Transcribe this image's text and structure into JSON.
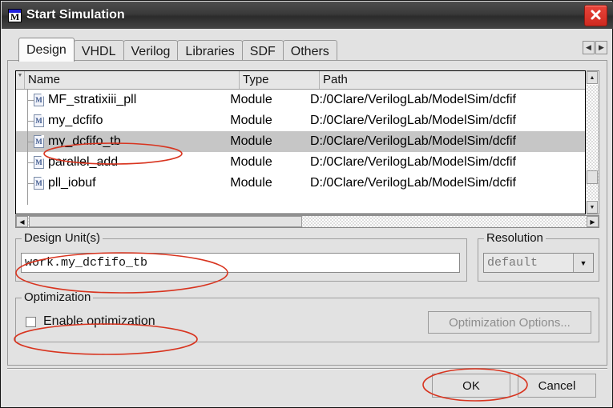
{
  "window": {
    "title": "Start Simulation",
    "app_icon": "M",
    "close_icon": "close-icon"
  },
  "tabs": [
    {
      "label": "Design",
      "active": true
    },
    {
      "label": "VHDL",
      "active": false
    },
    {
      "label": "Verilog",
      "active": false
    },
    {
      "label": "Libraries",
      "active": false
    },
    {
      "label": "SDF",
      "active": false
    },
    {
      "label": "Others",
      "active": false
    }
  ],
  "tab_scroll": {
    "left": "◀",
    "right": "▶"
  },
  "list": {
    "columns": [
      "Name",
      "Type",
      "Path"
    ],
    "sort_marker": "▼",
    "rows": [
      {
        "name": "MF_stratixiii_pll",
        "type": "Module",
        "path": "D:/0Clare/VerilogLab/ModelSim/dcfif",
        "icon": "M",
        "selected": false
      },
      {
        "name": "my_dcfifo",
        "type": "Module",
        "path": "D:/0Clare/VerilogLab/ModelSim/dcfif",
        "icon": "M",
        "selected": false
      },
      {
        "name": "my_dcfifo_tb",
        "type": "Module",
        "path": "D:/0Clare/VerilogLab/ModelSim/dcfif",
        "icon": "M",
        "selected": true
      },
      {
        "name": "parallel_add",
        "type": "Module",
        "path": "D:/0Clare/VerilogLab/ModelSim/dcfif",
        "icon": "M",
        "selected": false
      },
      {
        "name": "pll_iobuf",
        "type": "Module",
        "path": "D:/0Clare/VerilogLab/ModelSim/dcfif",
        "icon": "M",
        "selected": false
      }
    ],
    "vscroll": {
      "up": "▲",
      "down": "▼"
    },
    "hscroll": {
      "left": "◀",
      "right": "▶"
    }
  },
  "design_unit": {
    "legend": "Design Unit(s)",
    "value": "work.my_dcfifo_tb",
    "placeholder": ""
  },
  "resolution": {
    "legend": "Resolution",
    "value": "default",
    "arrow": "▼",
    "options": [
      "default"
    ]
  },
  "optimization": {
    "legend": "Optimization",
    "checkbox_label": "Enable optimization",
    "checked": false,
    "options_button": "Optimization Options..."
  },
  "footer": {
    "ok": "OK",
    "cancel": "Cancel"
  },
  "annotations": {
    "color": "#d8341f",
    "marks": [
      "selected-row-name",
      "design-unit-value",
      "enable-optimization",
      "ok-button"
    ]
  }
}
